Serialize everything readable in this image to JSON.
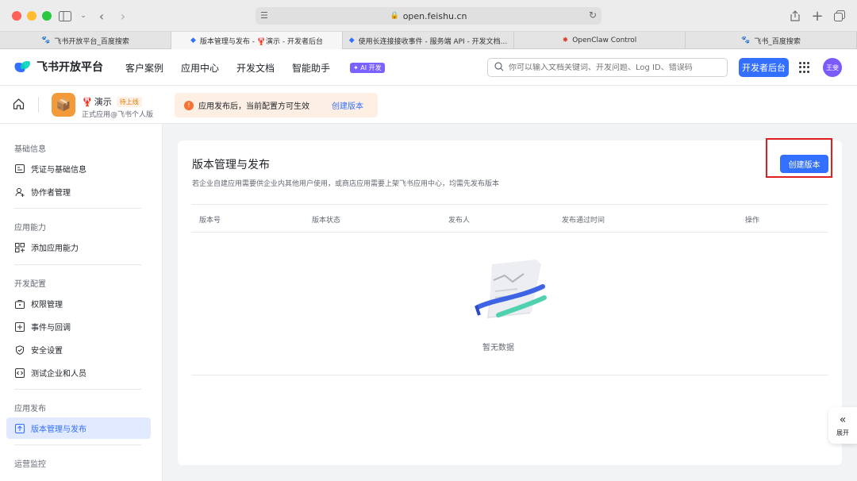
{
  "browser": {
    "url": "open.feishu.cn",
    "tabs": [
      {
        "label": "飞书开放平台_百度搜索",
        "icon": "baidu-paw-icon"
      },
      {
        "label": "版本管理与发布 - 🦞演示 - 开发者后台",
        "icon": "feishu-icon"
      },
      {
        "label": "使用长连接接收事件 - 服务端 API - 开发文档...",
        "icon": "feishu-icon"
      },
      {
        "label": "OpenClaw Control",
        "icon": "openclaw-icon"
      },
      {
        "label": "飞书_百度搜索",
        "icon": "baidu-paw-icon"
      }
    ]
  },
  "header": {
    "logo_text": "飞书开放平台",
    "nav": [
      "客户案例",
      "应用中心",
      "开发文档",
      "智能助手"
    ],
    "ai_badge": "✦ AI 开发",
    "search_placeholder": "你可以输入文档关键词、开发问题、Log ID、错误码",
    "dev_console_label": "开发者后台",
    "avatar_text": "王斐"
  },
  "app": {
    "icon_emoji": "📦",
    "name": "演示",
    "status_badge": "待上线",
    "type": "正式应用@飞书个人版",
    "notice_text": "应用发布后，当前配置方可生效",
    "notice_link": "创建版本"
  },
  "sidebar": {
    "sections": [
      {
        "title": "基础信息",
        "items": [
          "凭证与基础信息",
          "协作者管理"
        ]
      },
      {
        "title": "应用能力",
        "items": [
          "添加应用能力"
        ]
      },
      {
        "title": "开发配置",
        "items": [
          "权限管理",
          "事件与回调",
          "安全设置",
          "测试企业和人员"
        ]
      },
      {
        "title": "应用发布",
        "items": [
          "版本管理与发布"
        ]
      },
      {
        "title": "运营监控",
        "items": []
      }
    ]
  },
  "main": {
    "title": "版本管理与发布",
    "description": "若企业自建应用需要供企业内其他用户使用，或商店应用需要上架飞书应用中心，均需先发布版本",
    "create_button": "创建版本",
    "columns": [
      "版本号",
      "版本状态",
      "发布人",
      "发布通过时间",
      "操作"
    ],
    "empty_text": "暂无数据"
  },
  "expand": {
    "label": "展开"
  },
  "colors": {
    "primary": "#3370ff",
    "highlight": "#e02020",
    "app_icon": "#f39b3a"
  }
}
